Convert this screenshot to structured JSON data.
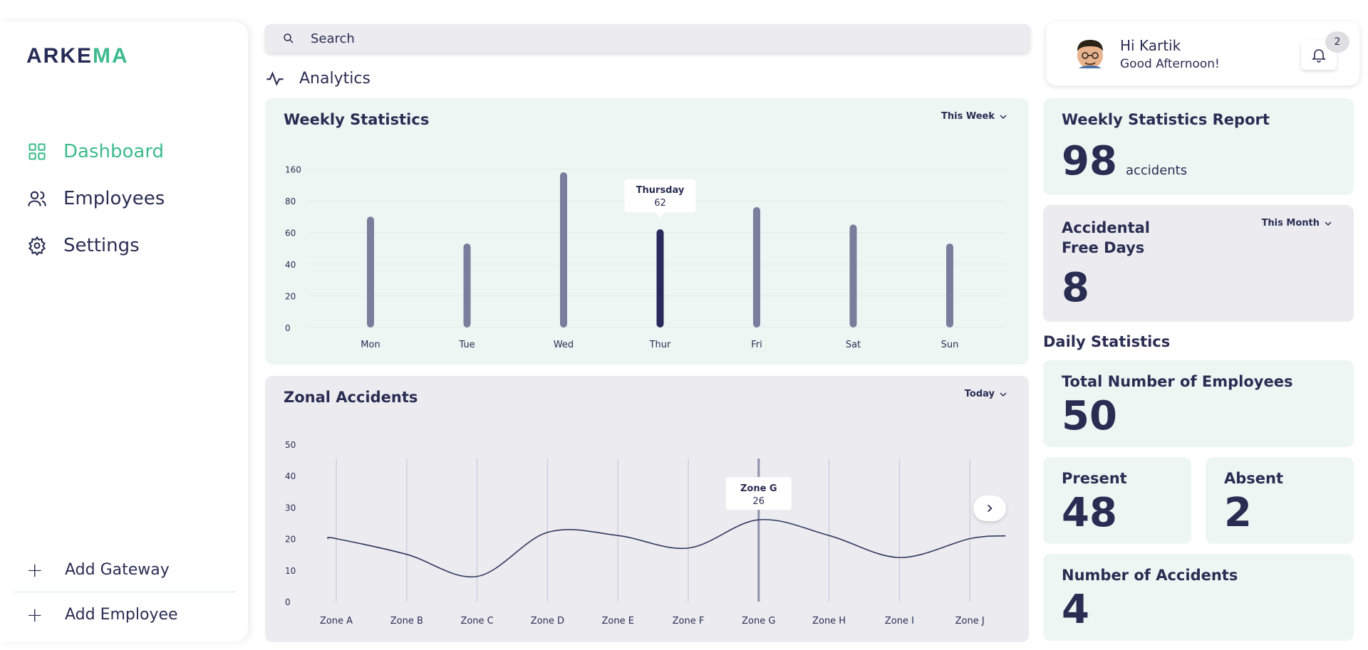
{
  "logo": {
    "prefix": "ARKE",
    "accent": "MA"
  },
  "sidebar": {
    "items": [
      {
        "label": "Dashboard",
        "icon": "grid-icon",
        "active": true
      },
      {
        "label": "Employees",
        "icon": "users-icon",
        "active": false
      },
      {
        "label": "Settings",
        "icon": "gear-icon",
        "active": false
      }
    ],
    "actions": [
      {
        "label": "Add Gateway",
        "icon": "plus-icon"
      },
      {
        "label": "Add Employee",
        "icon": "plus-icon"
      }
    ]
  },
  "search": {
    "placeholder": "Search"
  },
  "section": {
    "title": "Analytics"
  },
  "weekly_card": {
    "title": "Weekly Statistics",
    "filter": "This Week"
  },
  "zonal_card": {
    "title": "Zonal Accidents",
    "filter": "Today"
  },
  "user": {
    "greeting": "Hi Kartik",
    "subtitle": "Good Afternoon!",
    "notifications": "2"
  },
  "report": {
    "title": "Weekly Statistics Report",
    "value": "98",
    "unit": "accidents"
  },
  "free_days": {
    "title_line1": "Accidental",
    "title_line2": "Free Days",
    "filter": "This Month",
    "value": "8"
  },
  "daily": {
    "label": "Daily Statistics"
  },
  "employees_total": {
    "title": "Total Number of Employees",
    "value": "50"
  },
  "present": {
    "title": "Present",
    "value": "48"
  },
  "absent": {
    "title": "Absent",
    "value": "2"
  },
  "accidents": {
    "title": "Number of Accidents",
    "value": "4"
  },
  "colors": {
    "accent": "#3dbb8d",
    "navy": "#2a2d52",
    "bar": "#7a7d9c",
    "bar_highlight": "#272a5a",
    "card_green": "#eef6f4",
    "card_gray": "#ebebf0"
  },
  "chart_data": [
    {
      "type": "bar",
      "title": "Weekly Statistics",
      "categories": [
        "Mon",
        "Tue",
        "Wed",
        "Thur",
        "Fri",
        "Sat",
        "Sun"
      ],
      "values": [
        70,
        53,
        98,
        62,
        76,
        65,
        53
      ],
      "yticks": [
        "0",
        "20",
        "40",
        "60",
        "80",
        "160"
      ],
      "highlight": {
        "category": "Thur",
        "label": "Thursday",
        "value": 62
      },
      "grid": false
    },
    {
      "type": "line",
      "title": "Zonal Accidents",
      "categories": [
        "Zone A",
        "Zone B",
        "Zone C",
        "Zone D",
        "Zone E",
        "Zone F",
        "Zone G",
        "Zone H",
        "Zone I",
        "Zone J"
      ],
      "values": [
        20,
        15,
        8,
        22,
        21,
        17,
        26,
        21,
        14,
        20
      ],
      "ylim": [
        0,
        50
      ],
      "yticks": [
        "0",
        "10",
        "20",
        "30",
        "40",
        "50"
      ],
      "highlight": {
        "category": "Zone G",
        "label": "Zone G",
        "value": 26
      },
      "grid": true
    }
  ]
}
